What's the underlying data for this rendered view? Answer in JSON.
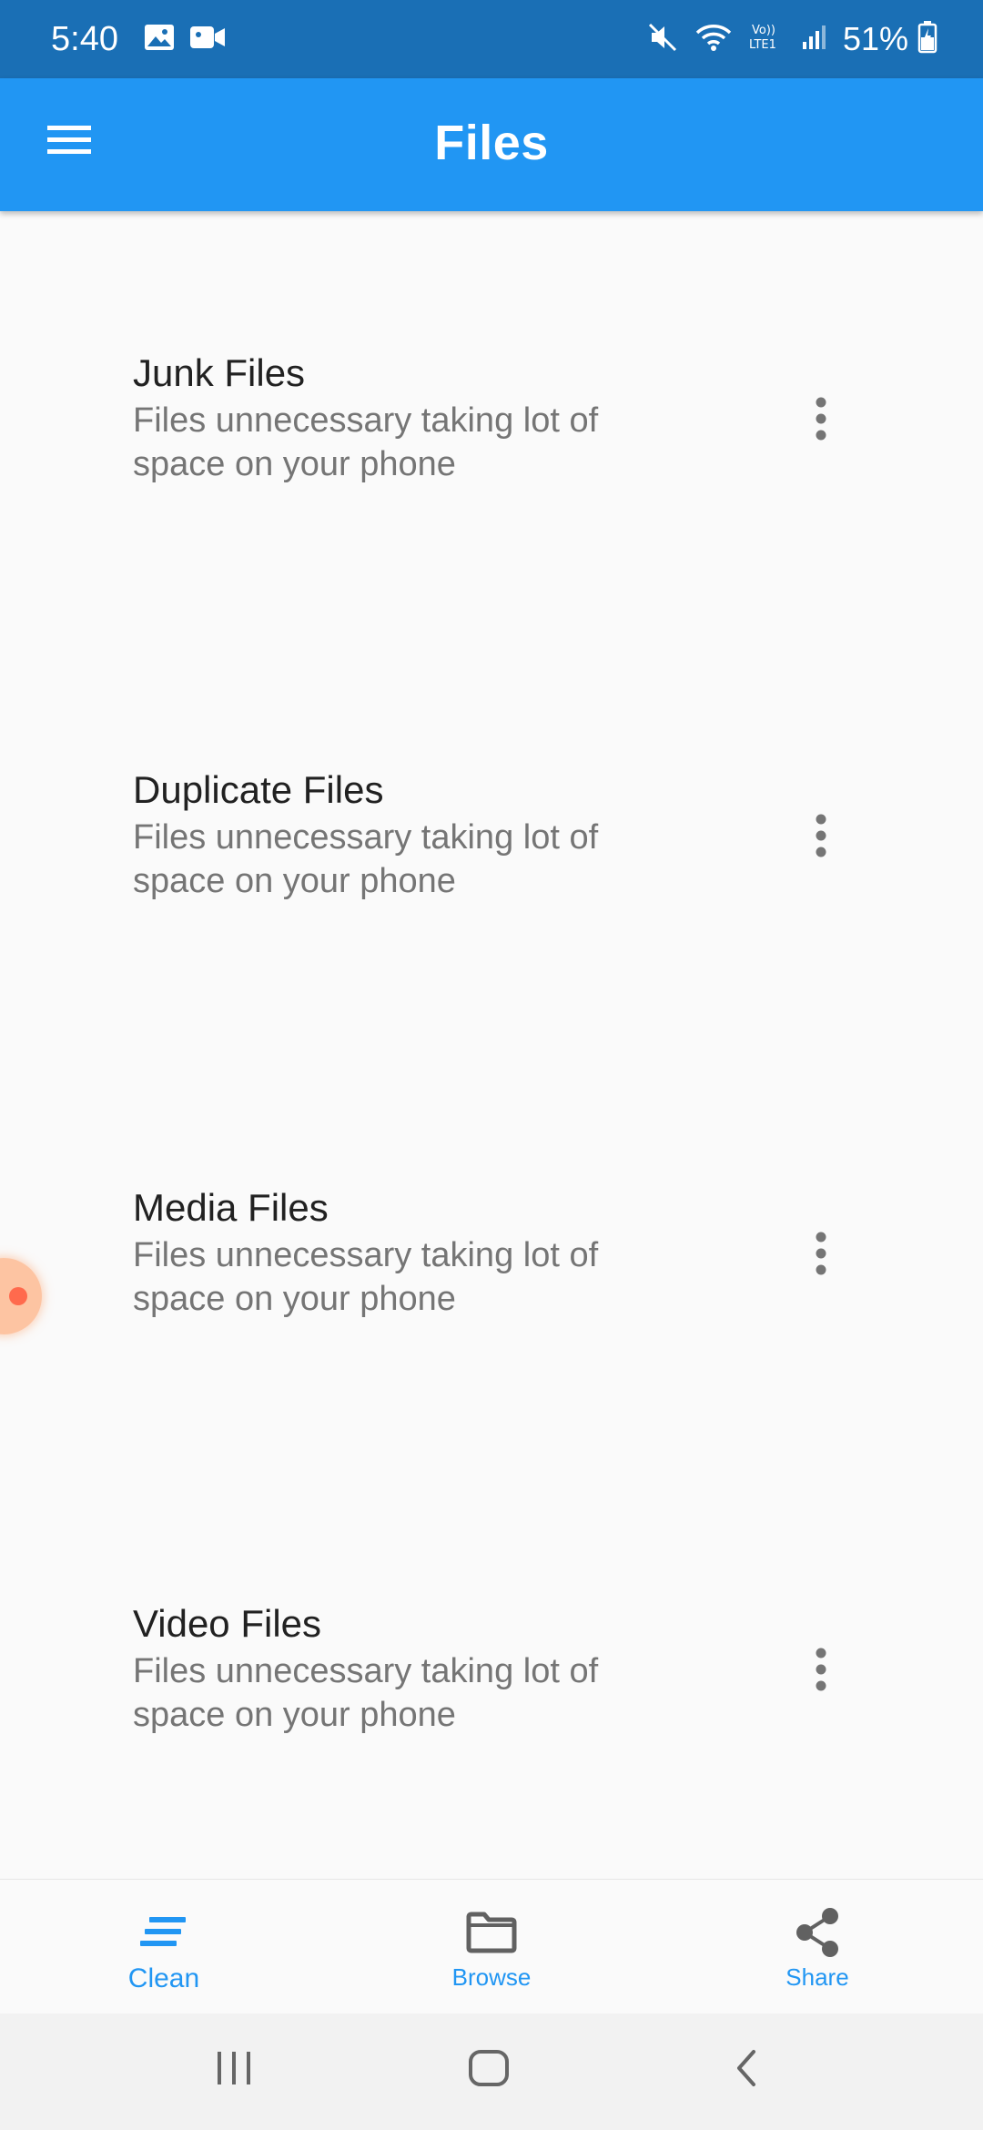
{
  "status_bar": {
    "time": "5:40",
    "battery": "51%",
    "icons": [
      "gallery-icon",
      "video-icon",
      "mute-icon",
      "wifi-icon",
      "volte-lte-icon",
      "signal-icon",
      "battery-charging-icon"
    ]
  },
  "app_bar": {
    "title": "Files",
    "menu_icon": "hamburger-menu-icon",
    "background": "#2196f3"
  },
  "items": [
    {
      "title": "Junk Files",
      "subtitle": "Files unnecessary taking lot of\n space on your phone"
    },
    {
      "title": "Duplicate Files",
      "subtitle": "Files unnecessary taking lot of\n space on your phone"
    },
    {
      "title": "Media Files",
      "subtitle": "Files unnecessary taking lot of\n space on your phone"
    },
    {
      "title": "Video Files",
      "subtitle": "Files unnecessary taking lot of\n space on your phone"
    }
  ],
  "bottom_nav": {
    "items": [
      {
        "label": "Clean",
        "icon": "clean-icon",
        "active": true
      },
      {
        "label": "Browse",
        "icon": "folder-icon",
        "active": false
      },
      {
        "label": "Share",
        "icon": "share-icon",
        "active": false
      }
    ],
    "accent": "#2196f3"
  },
  "system_nav": {
    "icons": [
      "recent-apps-icon",
      "home-icon",
      "back-icon"
    ]
  }
}
